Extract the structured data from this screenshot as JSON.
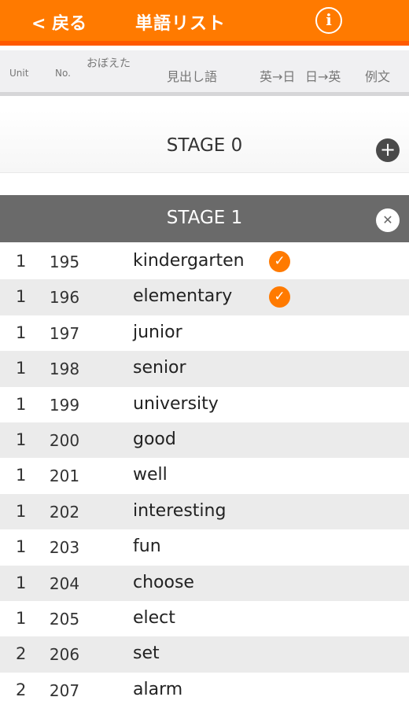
{
  "nav": {
    "back_label": "< 戻る",
    "title": "単語リスト",
    "info_glyph": "i",
    "accent_color": "#ff7a00"
  },
  "columns": {
    "unit": "Unit",
    "no": "No.",
    "memorized": "おぼえた",
    "headword": "見出し語",
    "en_to_ja": "英→日",
    "ja_to_en": "日→英",
    "example": "例文"
  },
  "stage0": {
    "label": "STAGE 0",
    "action_icon": "plus-icon"
  },
  "stage1": {
    "label": "STAGE 1",
    "action_icon": "close-icon"
  },
  "words": [
    {
      "unit": "1",
      "no": "195",
      "word": "kindergarten",
      "checked": true
    },
    {
      "unit": "1",
      "no": "196",
      "word": "elementary",
      "checked": true
    },
    {
      "unit": "1",
      "no": "197",
      "word": "junior",
      "checked": false
    },
    {
      "unit": "1",
      "no": "198",
      "word": "senior",
      "checked": false
    },
    {
      "unit": "1",
      "no": "199",
      "word": "university",
      "checked": false
    },
    {
      "unit": "1",
      "no": "200",
      "word": "good",
      "checked": false
    },
    {
      "unit": "1",
      "no": "201",
      "word": "well",
      "checked": false
    },
    {
      "unit": "1",
      "no": "202",
      "word": "interesting",
      "checked": false
    },
    {
      "unit": "1",
      "no": "203",
      "word": "fun",
      "checked": false
    },
    {
      "unit": "1",
      "no": "204",
      "word": "choose",
      "checked": false
    },
    {
      "unit": "1",
      "no": "205",
      "word": "elect",
      "checked": false
    },
    {
      "unit": "2",
      "no": "206",
      "word": "set",
      "checked": false
    },
    {
      "unit": "2",
      "no": "207",
      "word": "alarm",
      "checked": false
    }
  ]
}
